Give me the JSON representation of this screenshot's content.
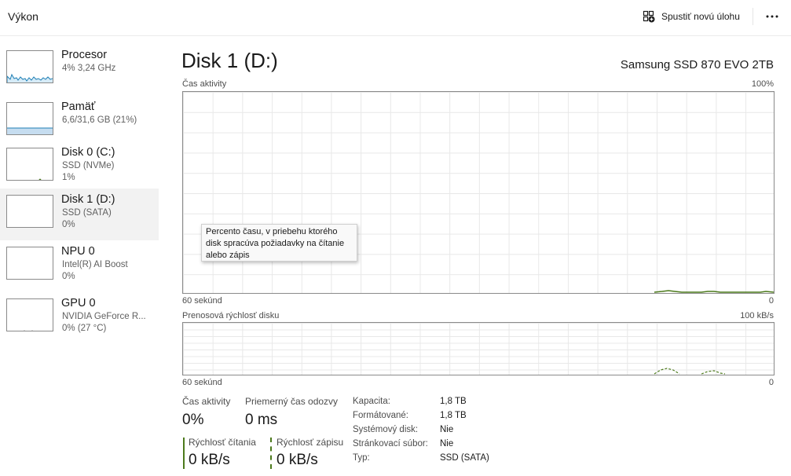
{
  "header": {
    "title": "Výkon",
    "new_task_label": "Spustiť novú úlohu",
    "more_icon": "more-horizontal-icon"
  },
  "sidebar": {
    "items": [
      {
        "name": "Procesor",
        "line1": "4% 3,24 GHz",
        "line2": ""
      },
      {
        "name": "Pamäť",
        "line1": "6,6/31,6 GB (21%)",
        "line2": ""
      },
      {
        "name": "Disk 0 (C:)",
        "line1": "SSD (NVMe)",
        "line2": "1%"
      },
      {
        "name": "Disk 1 (D:)",
        "line1": "SSD (SATA)",
        "line2": "0%"
      },
      {
        "name": "NPU 0",
        "line1": "Intel(R) AI Boost",
        "line2": "0%"
      },
      {
        "name": "GPU 0",
        "line1": "NVIDIA GeForce R...",
        "line2": "0% (27 °C)"
      }
    ],
    "selected_index": 3
  },
  "main": {
    "title": "Disk 1 (D:)",
    "model": "Samsung SSD 870 EVO 2TB",
    "activity_graph": {
      "label": "Čas aktivity",
      "max_label": "100%",
      "time_label": "60 sekúnd",
      "min_label": "0"
    },
    "transfer_graph": {
      "label": "Prenosová rýchlosť disku",
      "max_label": "100 kB/s",
      "time_label": "60 sekúnd",
      "min_label": "0"
    },
    "tooltip": "Percento času, v priebehu ktorého disk spracúva požiadavky na čítanie alebo zápis",
    "stats": {
      "activity_label": "Čas aktivity",
      "activity_value": "0%",
      "response_label": "Priemerný čas odozvy",
      "response_value": "0 ms",
      "read_label": "Rýchlosť čítania",
      "read_value": "0 kB/s",
      "write_label": "Rýchlosť zápisu",
      "write_value": "0 kB/s"
    },
    "properties": [
      {
        "key": "Kapacita:",
        "value": "1,8 TB"
      },
      {
        "key": "Formátované:",
        "value": "1,8 TB"
      },
      {
        "key": "Systémový disk:",
        "value": "Nie"
      },
      {
        "key": "Stránkovací súbor:",
        "value": "Nie"
      },
      {
        "key": "Typ:",
        "value": "SSD (SATA)"
      }
    ]
  },
  "colors": {
    "disk_accent": "#4c7a1c",
    "cpu_accent": "#1f7fb5",
    "selected_bg": "#f2f2f2"
  }
}
